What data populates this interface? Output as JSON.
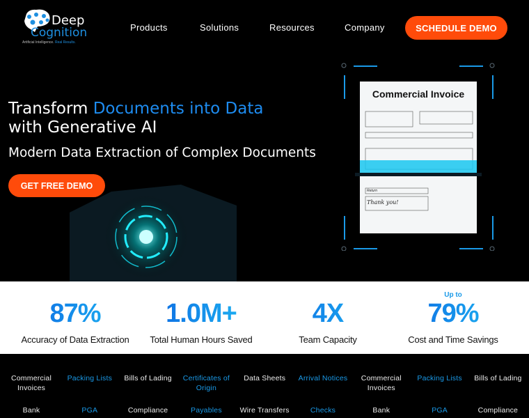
{
  "header": {
    "logo": {
      "line1": "Deep",
      "line2": "Cognition",
      "tagline_a": "Artificial Intelligence.",
      "tagline_b": "Real Results."
    },
    "nav": [
      "Products",
      "Solutions",
      "Resources",
      "Company"
    ],
    "cta": "SCHEDULE DEMO"
  },
  "hero": {
    "title_a": "Transform ",
    "title_highlight": "Documents into Data",
    "title_b": "with Generative AI",
    "subtitle": "Modern Data Extraction of Complex Documents",
    "button": "GET FREE DEMO",
    "invoice_title": "Commercial Invoice",
    "invoice_note_a": "Return",
    "invoice_note_b": "Thank you!"
  },
  "stats": [
    {
      "prefix": "",
      "value": "87%",
      "label": "Accuracy of Data Extraction"
    },
    {
      "prefix": "",
      "value": "1.0M+",
      "label": "Total Human Hours Saved"
    },
    {
      "prefix": "",
      "value": "4X",
      "label": "Team Capacity"
    },
    {
      "prefix": "Up to",
      "value": "79%",
      "label": "Cost and Time Savings"
    }
  ],
  "ticker_row1": [
    "Commercial Invoices",
    "Packing Lists",
    "Bills of Lading",
    "Certificates of Origin",
    "Data Sheets",
    "Arrival Notices",
    "Commercial Invoices",
    "Packing Lists",
    "Bills of Lading"
  ],
  "ticker_row2": [
    "Bank",
    "PGA",
    "Compliance",
    "Payables",
    "Wire Transfers",
    "Checks",
    "Bank",
    "PGA",
    "Compliance"
  ],
  "colors": {
    "accent": "#ff4b0a",
    "blue": "#1e8cf0",
    "ticker_blue": "#1a9ae8"
  }
}
